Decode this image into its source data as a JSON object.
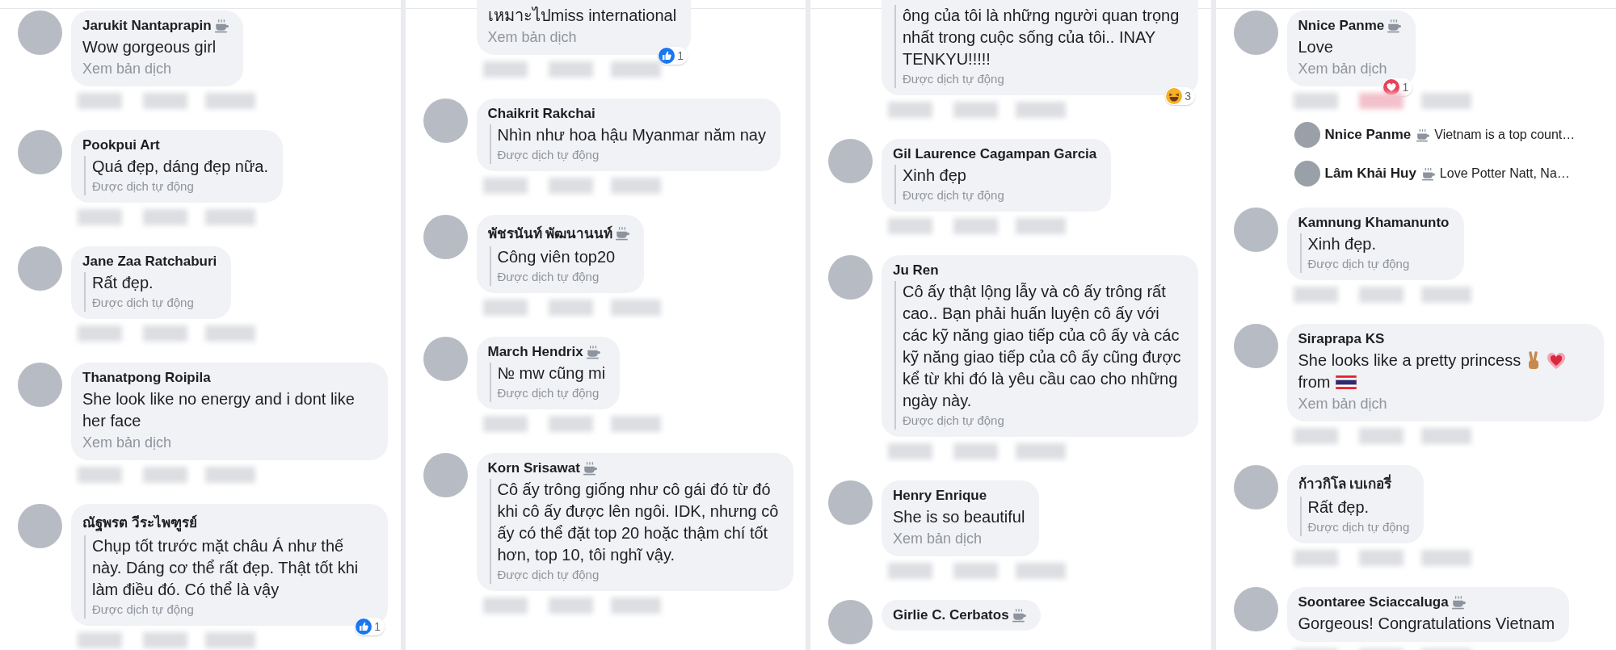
{
  "panels": [
    {
      "comments": [
        {
          "name": "Jarukit Nantaprapin",
          "top_fan": true,
          "text": "Wow gorgeous girl",
          "auto_translated": false,
          "translation": "Xem bản dịch"
        },
        {
          "name": "Pookpui Art",
          "top_fan": false,
          "text": "Quá đẹp, dáng đẹp nữa.",
          "auto_translated": true,
          "translation": "Được dịch tự động"
        },
        {
          "name": "Jane Zaa Ratchaburi",
          "top_fan": false,
          "text": "Rất đẹp.",
          "auto_translated": true,
          "translation": "Được dịch tự động"
        },
        {
          "name": "Thanatpong Roipila",
          "top_fan": false,
          "text": "She look like no energy and i dont like her face",
          "auto_translated": false,
          "translation": "Xem bản dịch"
        },
        {
          "name": "ณัฐพรต วีระไพฑูรย์",
          "top_fan": false,
          "text": "Chụp tốt trước mặt châu Á như thế này. Dáng cơ thể rất đẹp. Thật tốt khi làm điều đó. Có thể là vậy",
          "auto_translated": true,
          "translation": "Được dịch tự động",
          "reaction": {
            "kind": "like",
            "count": "1"
          }
        }
      ]
    },
    {
      "comments": [
        {
          "text": "เหมาะไปmiss international",
          "auto_translated": false,
          "translation": "Xem bản dịch",
          "reaction": {
            "kind": "like",
            "count": "1"
          }
        },
        {
          "name": "Chaikrit Rakchai",
          "top_fan": false,
          "text": "Nhìn như hoa hậu Myanmar năm nay",
          "auto_translated": true,
          "translation": "Được dịch tự động"
        },
        {
          "name": "พัชรนันท์ พัฒนานนท์",
          "top_fan": true,
          "text": "Công viên top20",
          "auto_translated": true,
          "translation": "Được dịch tự động"
        },
        {
          "name": "March Hendrix",
          "top_fan": true,
          "text": "№ mw cũng mi",
          "auto_translated": true,
          "translation": "Được dịch tự động"
        },
        {
          "name": "Korn Srisawat",
          "top_fan": true,
          "text": "Cô ấy trông giống như cô gái đó từ đó khi cô ấy được lên ngôi. IDK, nhưng cô ấy có thể đặt top 20 hoặc thậm chí tốt hơn, top 10, tôi nghĩ vậy.",
          "auto_translated": true,
          "translation": "Được dịch tự động"
        }
      ]
    },
    {
      "comments": [
        {
          "text": "ông của tôi là những người quan trọng nhất trong cuộc sống của tôi.. INAY TENKYU!!!!!",
          "auto_translated": true,
          "translation": "Được dịch tự động",
          "reaction": {
            "kind": "haha",
            "count": "3"
          }
        },
        {
          "name": "Gil Laurence Cagampan Garcia",
          "top_fan": false,
          "text": "Xinh đẹp",
          "auto_translated": true,
          "translation": "Được dịch tự động"
        },
        {
          "name": "Ju Ren",
          "top_fan": false,
          "text": "Cô ấy thật lộng lẫy và cô ấy trông rất cao.. Bạn phải huấn luyện cô ấy với các kỹ năng giao tiếp của cô ấy và các kỹ năng giao tiếp của cô ấy cũng được kể từ khi đó là yêu cầu cao cho những ngày này.",
          "auto_translated": true,
          "translation": "Được dịch tự động"
        },
        {
          "name": "Henry Enrique",
          "top_fan": false,
          "text": "She is so beautiful",
          "auto_translated": false,
          "translation": "Xem bản dịch"
        },
        {
          "name": "Girlie C. Cerbatos",
          "top_fan": true
        }
      ]
    },
    {
      "comments": [
        {
          "name": "Nnice Panme",
          "top_fan": true,
          "text": "Love",
          "auto_translated": false,
          "translation": "Xem bản dịch",
          "reaction": {
            "kind": "love",
            "count": "1"
          },
          "replies": [
            {
              "name": "Nnice Panme",
              "top_fan": true,
              "text": "Vietnam is a top count…"
            },
            {
              "name": "Lâm Khải Huy",
              "top_fan": true,
              "text": "Love Potter Natt, Na…"
            }
          ]
        },
        {
          "name": "Kamnung Khamanunto",
          "top_fan": false,
          "text": "Xinh đẹp.",
          "auto_translated": true,
          "translation": "Được dịch tự động"
        },
        {
          "name": "Siraprapa KS",
          "top_fan": false,
          "text_parts": [
            {
              "kind": "text",
              "value": "She looks like a pretty princess"
            },
            {
              "kind": "victory_hand"
            },
            {
              "kind": "heart"
            },
            {
              "kind": "text",
              "value": "from"
            },
            {
              "kind": "thai_flag"
            }
          ],
          "auto_translated": false,
          "translation": "Xem bản dịch"
        },
        {
          "name": "ก้าวกิโล เบเกอรี่",
          "top_fan": false,
          "text": "Rất đẹp.",
          "auto_translated": true,
          "translation": "Được dịch tự động"
        },
        {
          "name": "Soontaree Sciaccaluga",
          "top_fan": true,
          "text": "Gorgeous! Congratulations Vietnam"
        }
      ]
    }
  ]
}
